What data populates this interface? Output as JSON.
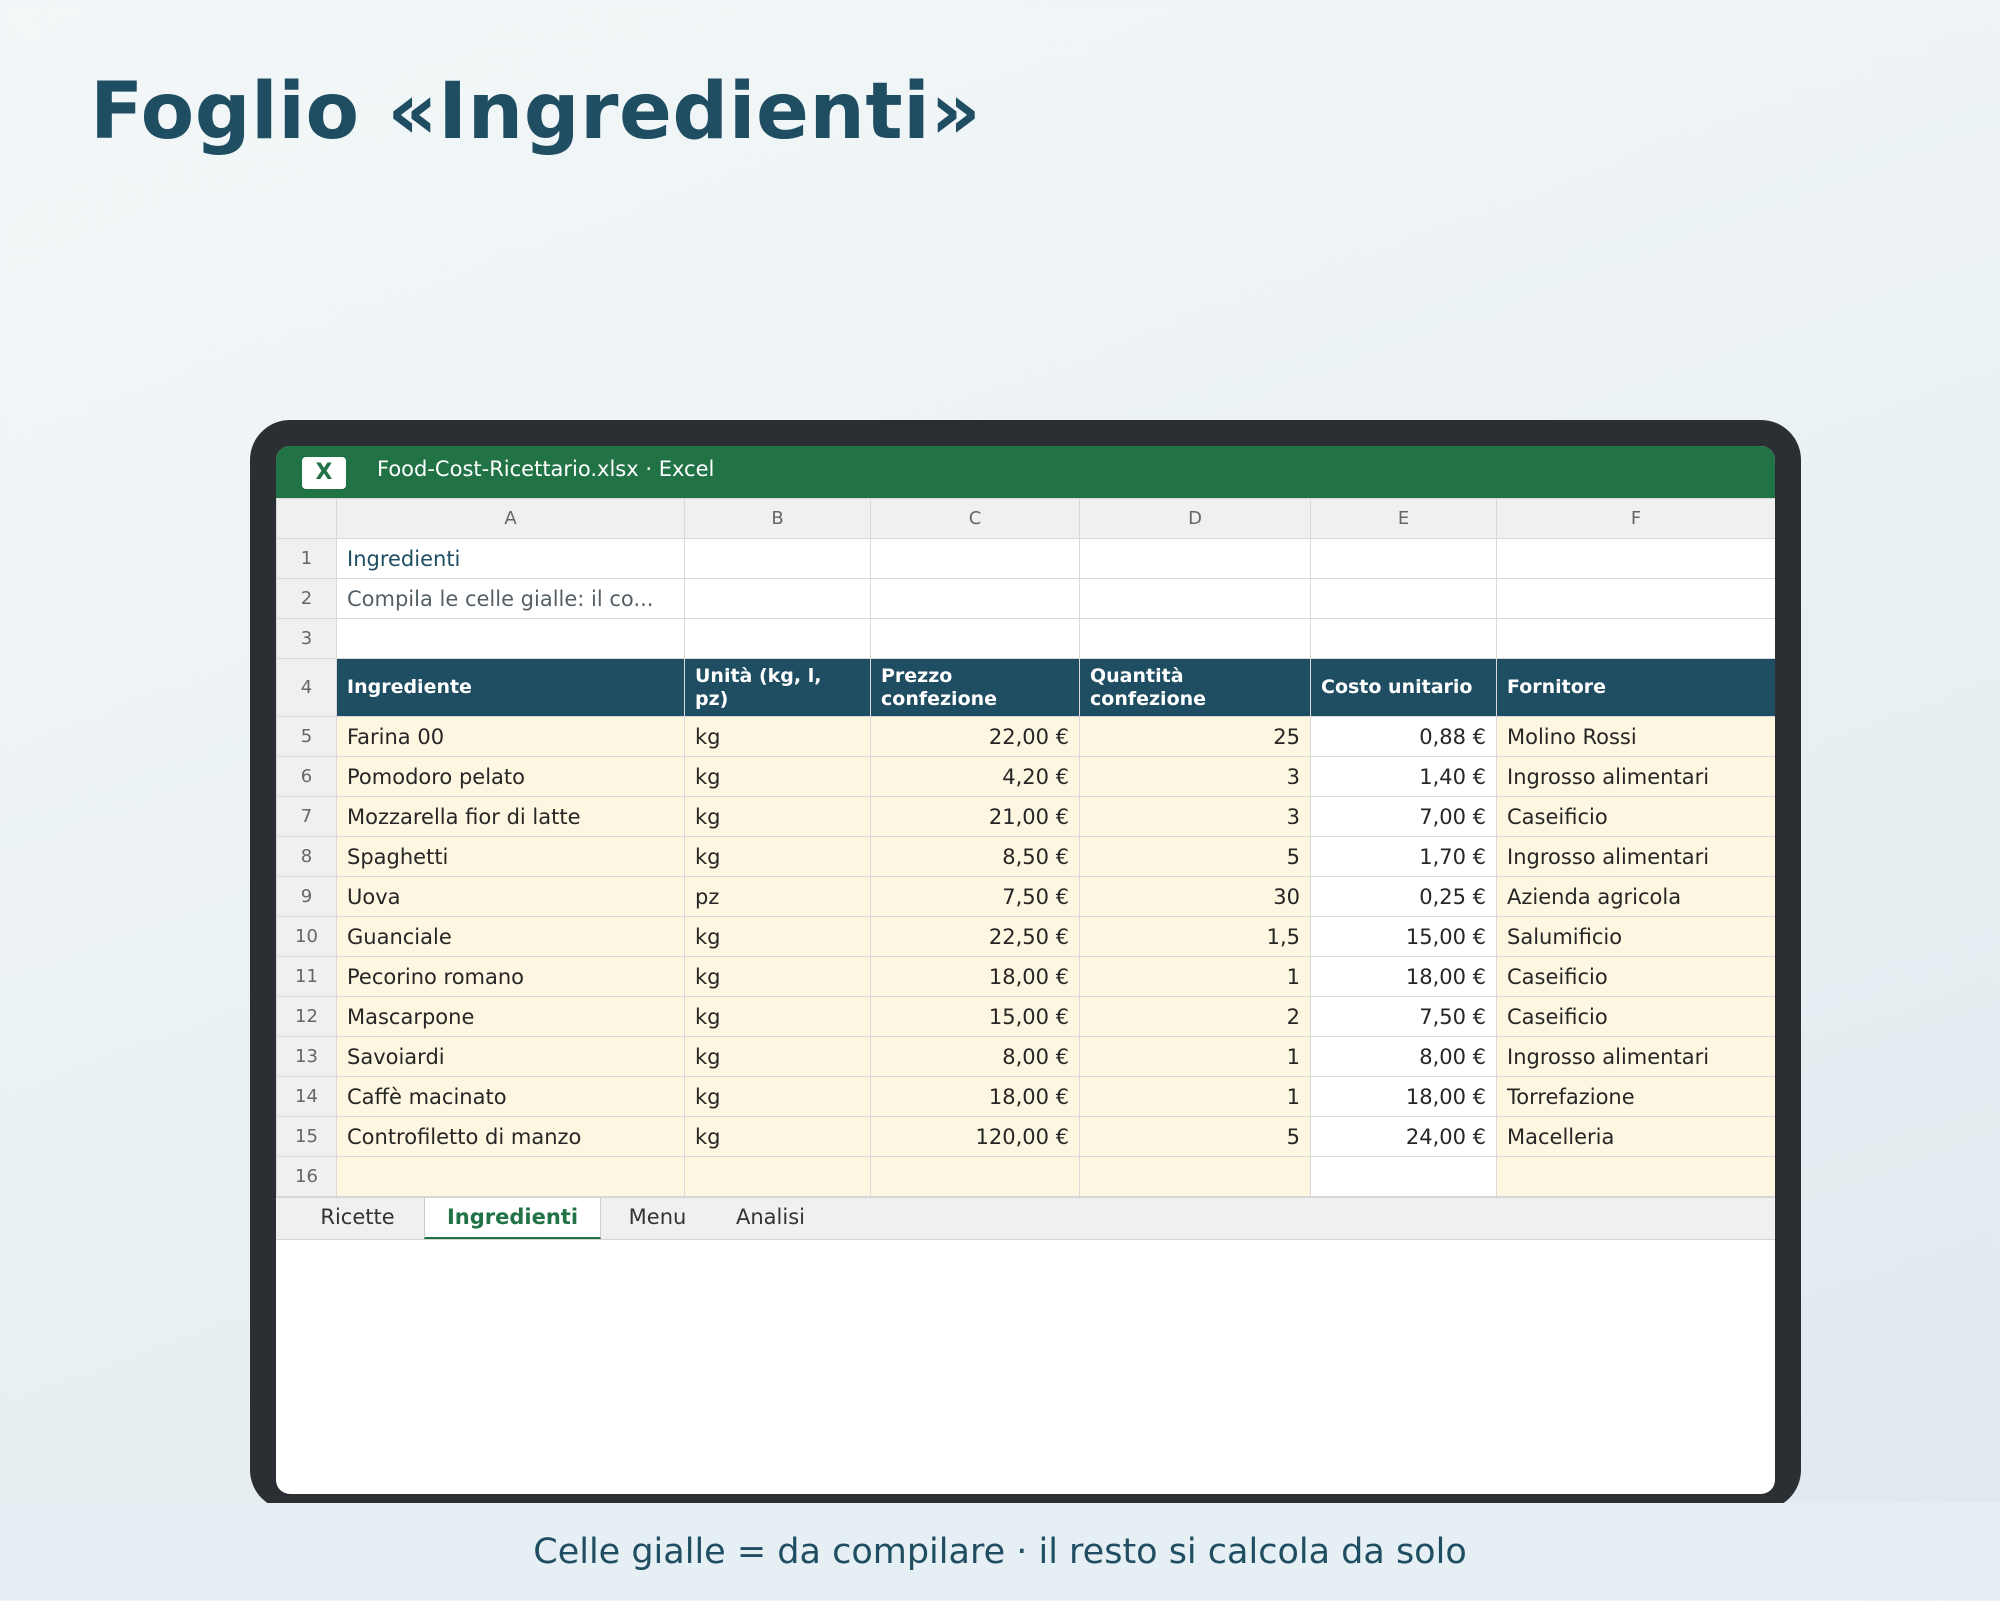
{
  "slide": {
    "title": "Foglio «Ingredienti»",
    "caption": "Celle gialle = da compilare · il resto si calcola da solo"
  },
  "window": {
    "app_icon_letter": "X",
    "title": "Food-Cost-Ricettario.xlsx · Excel"
  },
  "columns": [
    "A",
    "B",
    "C",
    "D",
    "E",
    "F"
  ],
  "sheet": {
    "title": "Ingredienti",
    "note": "Compila le celle gialle: il co...",
    "headers": [
      "Ingrediente",
      "Unità (kg, l, pz)",
      "Prezzo confezione",
      "Quantità confezione",
      "Costo unitario",
      "Fornitore"
    ],
    "rows": [
      [
        "Farina 00",
        "kg",
        "22,00 €",
        "25",
        "0,88 €",
        "Molino Rossi"
      ],
      [
        "Pomodoro pelato",
        "kg",
        "4,20 €",
        "3",
        "1,40 €",
        "Ingrosso alimentari"
      ],
      [
        "Mozzarella fior di latte",
        "kg",
        "21,00 €",
        "3",
        "7,00 €",
        "Caseificio"
      ],
      [
        "Spaghetti",
        "kg",
        "8,50 €",
        "5",
        "1,70 €",
        "Ingrosso alimentari"
      ],
      [
        "Uova",
        "pz",
        "7,50 €",
        "30",
        "0,25 €",
        "Azienda agricola"
      ],
      [
        "Guanciale",
        "kg",
        "22,50 €",
        "1,5",
        "15,00 €",
        "Salumificio"
      ],
      [
        "Pecorino romano",
        "kg",
        "18,00 €",
        "1",
        "18,00 €",
        "Caseificio"
      ],
      [
        "Mascarpone",
        "kg",
        "15,00 €",
        "2",
        "7,50 €",
        "Caseificio"
      ],
      [
        "Savoiardi",
        "kg",
        "8,00 €",
        "1",
        "8,00 €",
        "Ingrosso alimentari"
      ],
      [
        "Caffè macinato",
        "kg",
        "18,00 €",
        "1",
        "18,00 €",
        "Torrefazione"
      ],
      [
        "Controfiletto di manzo",
        "kg",
        "120,00 €",
        "5",
        "24,00 €",
        "Macelleria"
      ]
    ]
  },
  "row_numbers": [
    "1",
    "2",
    "3",
    "4",
    "5",
    "6",
    "7",
    "8",
    "9",
    "10",
    "11",
    "12",
    "13",
    "14",
    "15",
    "16"
  ],
  "tabs": [
    "Ricette",
    "Ingredienti",
    "Menu",
    "Analisi"
  ],
  "active_tab": "Ingredienti",
  "colors": {
    "input_cell": "#fdf6e0",
    "header_fill": "#1f4e62",
    "excel_green": "#217346"
  }
}
